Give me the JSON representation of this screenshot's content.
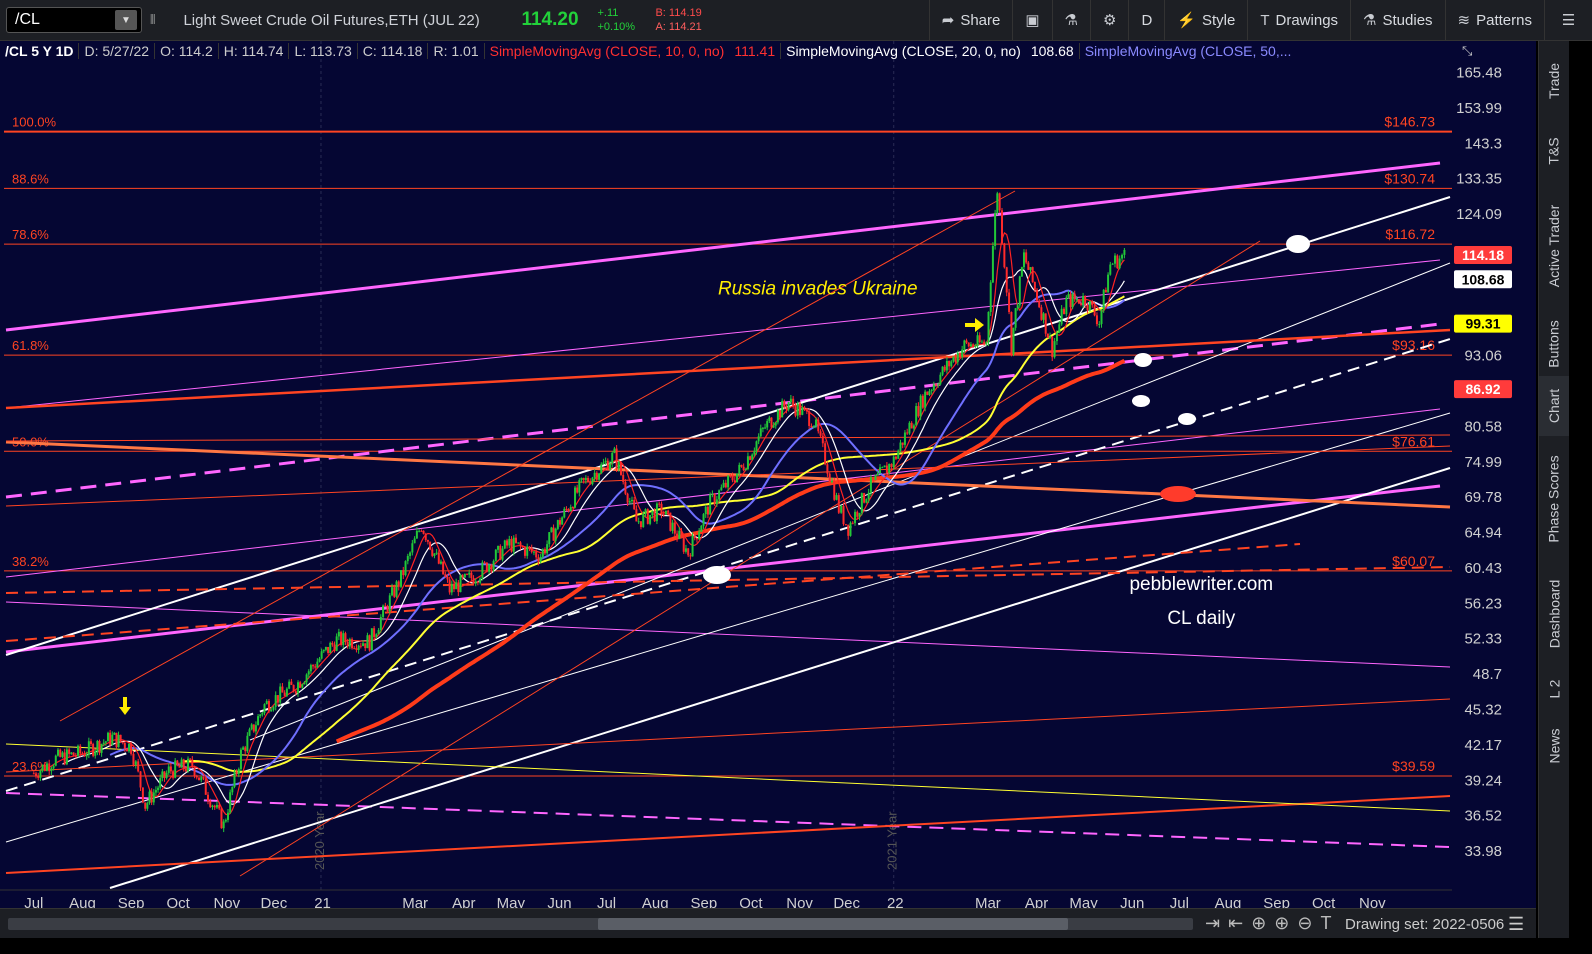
{
  "toolbar": {
    "symbol": "/CL",
    "description": "Light Sweet Crude Oil Futures,ETH (JUL 22)",
    "last": "114.20",
    "change": "+.11",
    "change_pct": "+0.10%",
    "bid": "B: 114.19",
    "ask": "A: 114.21",
    "share": "Share",
    "period": "D",
    "style": "Style",
    "drawings": "Drawings",
    "studies": "Studies",
    "patterns": "Patterns",
    "colors": {
      "up": "#22d13a",
      "down": "#ff4b4b",
      "bg": "#050633"
    }
  },
  "header": {
    "symbol": "/CL 5 Y 1D",
    "date": "D: 5/27/22",
    "open": "O: 114.2",
    "high": "H: 114.74",
    "low": "L: 113.73",
    "close": "C: 114.18",
    "range": "R: 1.01",
    "sma10": "SimpleMovingAvg (CLOSE, 10, 0, no)",
    "sma10_val": "111.41",
    "sma20": "SimpleMovingAvg (CLOSE, 20, 0, no)",
    "sma20_val": "108.68",
    "sma50": "SimpleMovingAvg (CLOSE, 50,..."
  },
  "right_tabs": [
    "Trade",
    "T&S",
    "Active Trader",
    "Buttons",
    "Chart",
    "Phase Scores",
    "Dashboard",
    "L 2",
    "News"
  ],
  "active_tab": "Chart",
  "bottom": {
    "drawing_set": "Drawing set: 2022-0506"
  },
  "chart_data": {
    "type": "candlestick",
    "symbol": "/CL daily",
    "x_range": [
      "2020-07-01",
      "2022-11-30"
    ],
    "ylim": [
      32.5,
      167
    ],
    "y_ticks": [
      "165.48",
      "153.99",
      "143.3",
      "133.35",
      "124.09",
      "114.18",
      "108.68",
      "99.31",
      "93.06",
      "86.92",
      "80.58",
      "74.99",
      "69.78",
      "64.94",
      "60.43",
      "56.23",
      "52.33",
      "48.7",
      "45.32",
      "42.17",
      "39.24",
      "36.52",
      "33.98"
    ],
    "y_tick_values": [
      165.48,
      153.99,
      143.3,
      133.35,
      124.09,
      114.18,
      108.68,
      99.31,
      93.06,
      86.92,
      80.58,
      74.99,
      69.78,
      64.94,
      60.43,
      56.23,
      52.33,
      48.7,
      45.32,
      42.17,
      39.24,
      36.52,
      33.98
    ],
    "price_badges": [
      {
        "label": "114.18",
        "value": 114.18,
        "color": "#ff3b3b",
        "text": "#ffffff"
      },
      {
        "label": "108.68",
        "value": 108.68,
        "color": "#ffffff",
        "text": "#000000"
      },
      {
        "label": "99.31",
        "value": 99.31,
        "color": "#ffff00",
        "text": "#000000"
      },
      {
        "label": "86.92",
        "value": 86.92,
        "color": "#ff3b3b",
        "text": "#ffffff"
      }
    ],
    "x_ticks": [
      {
        "label": "Jul",
        "date": "2020-07-01"
      },
      {
        "label": "Aug",
        "date": "2020-08-01"
      },
      {
        "label": "Sep",
        "date": "2020-09-01"
      },
      {
        "label": "Oct",
        "date": "2020-10-01"
      },
      {
        "label": "Nov",
        "date": "2020-11-01"
      },
      {
        "label": "Dec",
        "date": "2020-12-01"
      },
      {
        "label": "21",
        "date": "2021-01-01"
      },
      {
        "label": "Mar",
        "date": "2021-03-01"
      },
      {
        "label": "Apr",
        "date": "2021-04-01"
      },
      {
        "label": "May",
        "date": "2021-05-01"
      },
      {
        "label": "Jun",
        "date": "2021-06-01"
      },
      {
        "label": "Jul",
        "date": "2021-07-01"
      },
      {
        "label": "Aug",
        "date": "2021-08-01"
      },
      {
        "label": "Sep",
        "date": "2021-09-01"
      },
      {
        "label": "Oct",
        "date": "2021-10-01"
      },
      {
        "label": "Nov",
        "date": "2021-11-01"
      },
      {
        "label": "Dec",
        "date": "2021-12-01"
      },
      {
        "label": "22",
        "date": "2022-01-01"
      },
      {
        "label": "Mar",
        "date": "2022-03-01"
      },
      {
        "label": "Apr",
        "date": "2022-04-01"
      },
      {
        "label": "May",
        "date": "2022-05-01"
      },
      {
        "label": "Jun",
        "date": "2022-06-01"
      },
      {
        "label": "Jul",
        "date": "2022-07-01"
      },
      {
        "label": "Aug",
        "date": "2022-08-01"
      },
      {
        "label": "Sep",
        "date": "2022-09-01"
      },
      {
        "label": "Oct",
        "date": "2022-10-01"
      },
      {
        "label": "Nov",
        "date": "2022-11-01"
      }
    ],
    "year_markers": [
      {
        "label": "2020 Year",
        "date": "2020-12-31"
      },
      {
        "label": "2021 Year",
        "date": "2021-12-31"
      }
    ],
    "fib_levels": [
      {
        "pct": "100.0%",
        "value": 146.73,
        "label": "$146.73"
      },
      {
        "pct": "88.6%",
        "value": 130.74,
        "label": "$130.74"
      },
      {
        "pct": "78.6%",
        "value": 116.72,
        "label": "$116.72"
      },
      {
        "pct": "61.8%",
        "value": 93.16,
        "label": "$93.16"
      },
      {
        "pct": "50.0%",
        "value": 76.61,
        "label": "$76.61"
      },
      {
        "pct": "38.2%",
        "value": 60.07,
        "label": "$60.07"
      },
      {
        "pct": "23.6%",
        "value": 39.59,
        "label": "$39.59"
      }
    ],
    "price_path": [
      [
        "2020-07-01",
        39.8
      ],
      [
        "2020-07-15",
        41.0
      ],
      [
        "2020-08-01",
        41.5
      ],
      [
        "2020-08-20",
        42.8
      ],
      [
        "2020-09-01",
        42.0
      ],
      [
        "2020-09-10",
        37.3
      ],
      [
        "2020-09-25",
        40.0
      ],
      [
        "2020-10-10",
        40.5
      ],
      [
        "2020-10-30",
        35.8
      ],
      [
        "2020-11-10",
        41.4
      ],
      [
        "2020-11-25",
        45.7
      ],
      [
        "2020-12-15",
        47.6
      ],
      [
        "2021-01-10",
        52.2
      ],
      [
        "2021-01-31",
        52.0
      ],
      [
        "2021-02-20",
        59.2
      ],
      [
        "2021-03-05",
        66.0
      ],
      [
        "2021-03-23",
        57.8
      ],
      [
        "2021-04-10",
        59.7
      ],
      [
        "2021-04-30",
        63.5
      ],
      [
        "2021-05-20",
        62.0
      ],
      [
        "2021-06-15",
        71.5
      ],
      [
        "2021-07-06",
        76.0
      ],
      [
        "2021-07-20",
        66.4
      ],
      [
        "2021-08-05",
        68.0
      ],
      [
        "2021-08-22",
        62.3
      ],
      [
        "2021-09-05",
        69.0
      ],
      [
        "2021-09-25",
        74.0
      ],
      [
        "2021-10-10",
        80.5
      ],
      [
        "2021-10-25",
        84.7
      ],
      [
        "2021-11-10",
        81.5
      ],
      [
        "2021-11-26",
        68.2
      ],
      [
        "2021-12-02",
        65.6
      ],
      [
        "2021-12-15",
        71.0
      ],
      [
        "2021-12-31",
        75.2
      ],
      [
        "2022-01-20",
        86.0
      ],
      [
        "2022-02-14",
        95.0
      ],
      [
        "2022-02-28",
        95.5
      ],
      [
        "2022-03-07",
        130.5
      ],
      [
        "2022-03-16",
        95.0
      ],
      [
        "2022-03-24",
        114.0
      ],
      [
        "2022-04-11",
        94.3
      ],
      [
        "2022-04-20",
        104.0
      ],
      [
        "2022-05-02",
        104.5
      ],
      [
        "2022-05-11",
        99.8
      ],
      [
        "2022-05-18",
        112.0
      ],
      [
        "2022-05-27",
        114.18
      ]
    ],
    "annotations": [
      {
        "text": "Russia invades Ukraine",
        "date": "2021-09-10",
        "value": 105.4
      },
      {
        "text": "pebblewriter.com",
        "date": "2022-07-15",
        "value": 57.8
      },
      {
        "text": "CL daily",
        "date": "2022-07-15",
        "value": 53.9
      }
    ],
    "grid": false,
    "legend": "top-left header"
  }
}
